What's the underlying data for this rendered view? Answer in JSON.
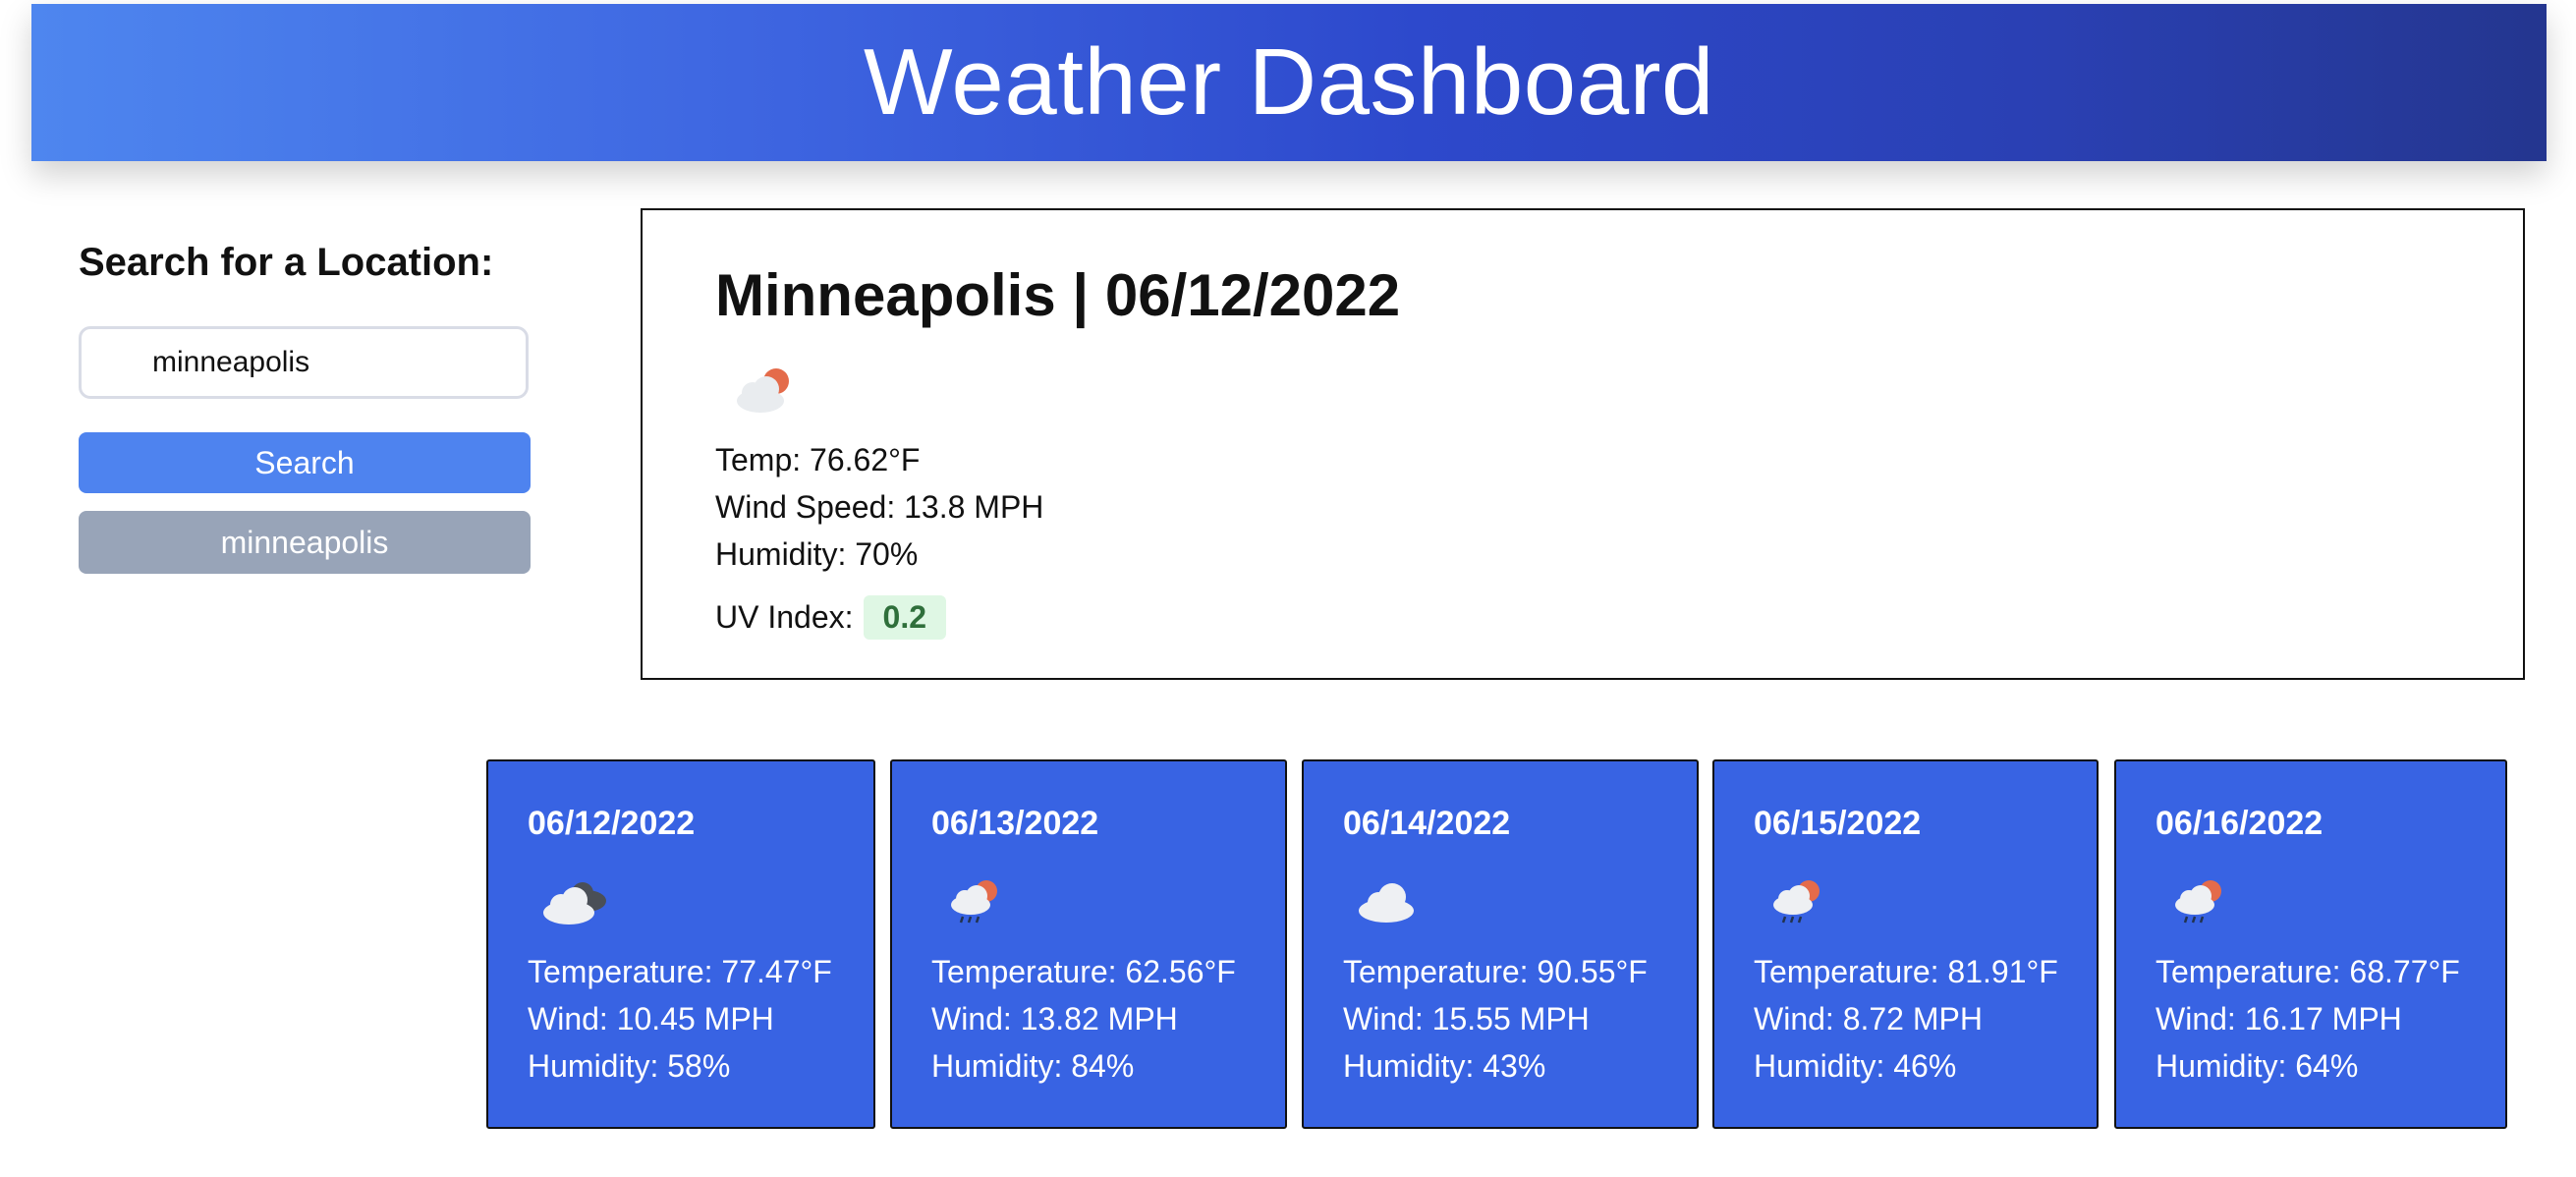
{
  "header": {
    "title": "Weather Dashboard"
  },
  "sidebar": {
    "search_label": "Search for a Location:",
    "search_value": "minneapolis",
    "search_button": "Search",
    "history": [
      "minneapolis"
    ]
  },
  "current": {
    "title": "Minneapolis | 06/12/2022",
    "icon": "sun-behind-cloud-icon",
    "temp": "Temp: 76.62°F",
    "wind": "Wind Speed: 13.8 MPH",
    "humidity": "Humidity: 70%",
    "uv_label": "UV Index:",
    "uv_value": "0.2",
    "uv_color": "#dff7e4"
  },
  "forecast": [
    {
      "date": "06/12/2022",
      "icon": "broken-clouds-icon",
      "temp": "Temperature: 77.47°F",
      "wind": "Wind: 10.45 MPH",
      "humidity": "Humidity: 58%"
    },
    {
      "date": "06/13/2022",
      "icon": "sun-rain-icon",
      "temp": "Temperature: 62.56°F",
      "wind": "Wind: 13.82 MPH",
      "humidity": "Humidity: 84%"
    },
    {
      "date": "06/14/2022",
      "icon": "cloud-icon",
      "temp": "Temperature: 90.55°F",
      "wind": "Wind: 15.55 MPH",
      "humidity": "Humidity: 43%"
    },
    {
      "date": "06/15/2022",
      "icon": "sun-rain-icon",
      "temp": "Temperature: 81.91°F",
      "wind": "Wind: 8.72 MPH",
      "humidity": "Humidity: 46%"
    },
    {
      "date": "06/16/2022",
      "icon": "sun-rain-icon",
      "temp": "Temperature: 68.77°F",
      "wind": "Wind: 16.17 MPH",
      "humidity": "Humidity: 64%"
    }
  ],
  "colors": {
    "header_start": "#4e86ef",
    "header_end": "#24368f",
    "search_button": "#4e83ef",
    "history_button": "#98a4b8",
    "card": "#3863e3"
  }
}
